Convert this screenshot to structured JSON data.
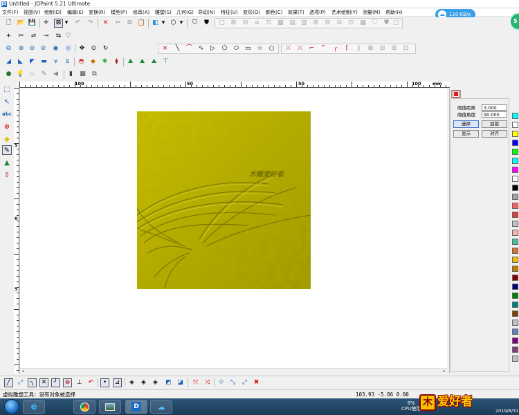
{
  "window": {
    "title": "Untitled - JDPaint 5.21 Ultimate",
    "app_icon": "JD"
  },
  "menubar": [
    "文件(F)",
    "视图(V)",
    "绘制(D)",
    "编辑(E)",
    "变换(R)",
    "模型(P)",
    "修改(A)",
    "雕塑(S)",
    "几何(G)",
    "导动(N)",
    "特征(U)",
    "变形(O)",
    "颜色(C)",
    "效果(T)",
    "选项(P)",
    "艺术绘制(Y)",
    "测量(M)",
    "帮助(H)"
  ],
  "network_badge": {
    "icon": "cloud-icon",
    "speed": "110 KB/s"
  },
  "speed_ball": {
    "value": "5"
  },
  "toolbars": {
    "row1": [
      "new-file-icon",
      "open-folder-icon",
      "save-icon",
      "print-icon",
      "crosshair-icon",
      "select-box-icon",
      "dropdown-arrow-icon",
      "undo-icon",
      "redo-icon",
      "delete-x-icon",
      "cut-icon",
      "copy-icon",
      "paste-icon",
      "layer-cube-icon",
      "dropdown-arrow-icon",
      "view-3d-icon",
      "dropdown-arrow-icon",
      "shield-icon",
      "shield-fill-icon"
    ],
    "row2": [
      "pan-plus-icon",
      "scissors-icon",
      "node-edit-icon",
      "rotate-icon",
      "align-icon"
    ],
    "row3": [
      "zoom-window-icon",
      "zoom-in-icon",
      "zoom-out-icon",
      "zoom-prev-icon",
      "view-eye-icon",
      "move-hand-icon",
      "zoom-all-icon",
      "refresh-icon",
      "point-icon",
      "line-icon",
      "arc-icon",
      "spline-icon",
      "triangle-icon",
      "polygon-icon",
      "ellipse-icon",
      "rectangle-icon",
      "star-icon",
      "circle-icon",
      "trim-icon",
      "extend-icon",
      "corner-icon",
      "chamfer-icon",
      "fillet-icon",
      "offset-icon",
      "array-icon",
      "mirror-icon",
      "scale-icon"
    ],
    "row4": [
      "region-relief-icon",
      "smooth-icon",
      "emboss-icon",
      "stamp-icon",
      "funnel-icon",
      "mesh-icon",
      "bump-icon",
      "color-wheel-icon",
      "diamond-icon",
      "pattern-icon",
      "sculpt-up-icon",
      "sculpt-down-icon",
      "sculpt-flat-icon",
      "tee-icon"
    ],
    "row5": [
      "bulb-icon",
      "light-icon",
      "lamp-icon",
      "brush-icon",
      "speaker-icon",
      "material-icon",
      "texture-icon"
    ]
  },
  "rulers": {
    "h_labels": [
      "100",
      "50",
      "0",
      "50",
      "100",
      "mm"
    ],
    "v_labels": [
      "5",
      "0",
      "5"
    ]
  },
  "left_tools": [
    "select-rect-icon",
    "node-tool-icon",
    "text-abc-icon",
    "transform-icon",
    "diamond-fill-icon",
    "pencil-icon",
    "funnel-icon",
    "axis-icon"
  ],
  "relief": {
    "watermark": "木雕爱好者",
    "color": "#b9b000"
  },
  "panel": {
    "tab_icon": "relief-panel-icon",
    "fields": [
      {
        "label": "阈值距离",
        "value": "3.000"
      },
      {
        "label": "阈值角度",
        "value": "90.000"
      }
    ],
    "buttons": [
      "选择",
      "加锁",
      "显示",
      "对齐"
    ]
  },
  "palette": [
    "#00ffff",
    "#ffffff",
    "#ffff00",
    "#0000ff",
    "#00ff00",
    "#00ffff",
    "#ff00ff",
    "#ffffff",
    "#000000",
    "#a0a0a0",
    "#ff6060",
    "#e04040",
    "#c0c0c0",
    "#ffb0b0",
    "#40c0a0",
    "#e07030",
    "#f0c000",
    "#c08000",
    "#800000",
    "#000080",
    "#008000",
    "#008080",
    "#804000",
    "#c0c0c0",
    "#6080c0",
    "#800080",
    "#804080",
    "#c0c0c0"
  ],
  "bottom_tools": [
    "line-tool-icon",
    "arc-tool-icon",
    "corner-tool-icon",
    "cross-tool-icon",
    "fillet-tool-icon",
    "circle-target-icon",
    "perp-icon",
    "tangent-icon",
    "dot-icon",
    "snap-icon",
    "grid-snap-icon",
    "edge-snap-icon",
    "face-snap-icon",
    "surface-icon",
    "measure-icon",
    "close-x-icon",
    "pick-x-icon",
    "node-icon",
    "join-icon",
    "break-icon",
    "stop-x-icon"
  ],
  "status": {
    "message": "虚拟雕塑工具：设有对象被选择",
    "coords": "103.93  -5.86  0.00"
  },
  "taskbar": {
    "apps": [
      "ie-icon",
      "chrome-icon",
      "photo-icon",
      "jdpaint-icon",
      "cloud-drive-icon"
    ],
    "cpu_percent": "9%",
    "cpu_label": "CPU使用",
    "date": "2019/8/31",
    "brand": "爱好者"
  }
}
